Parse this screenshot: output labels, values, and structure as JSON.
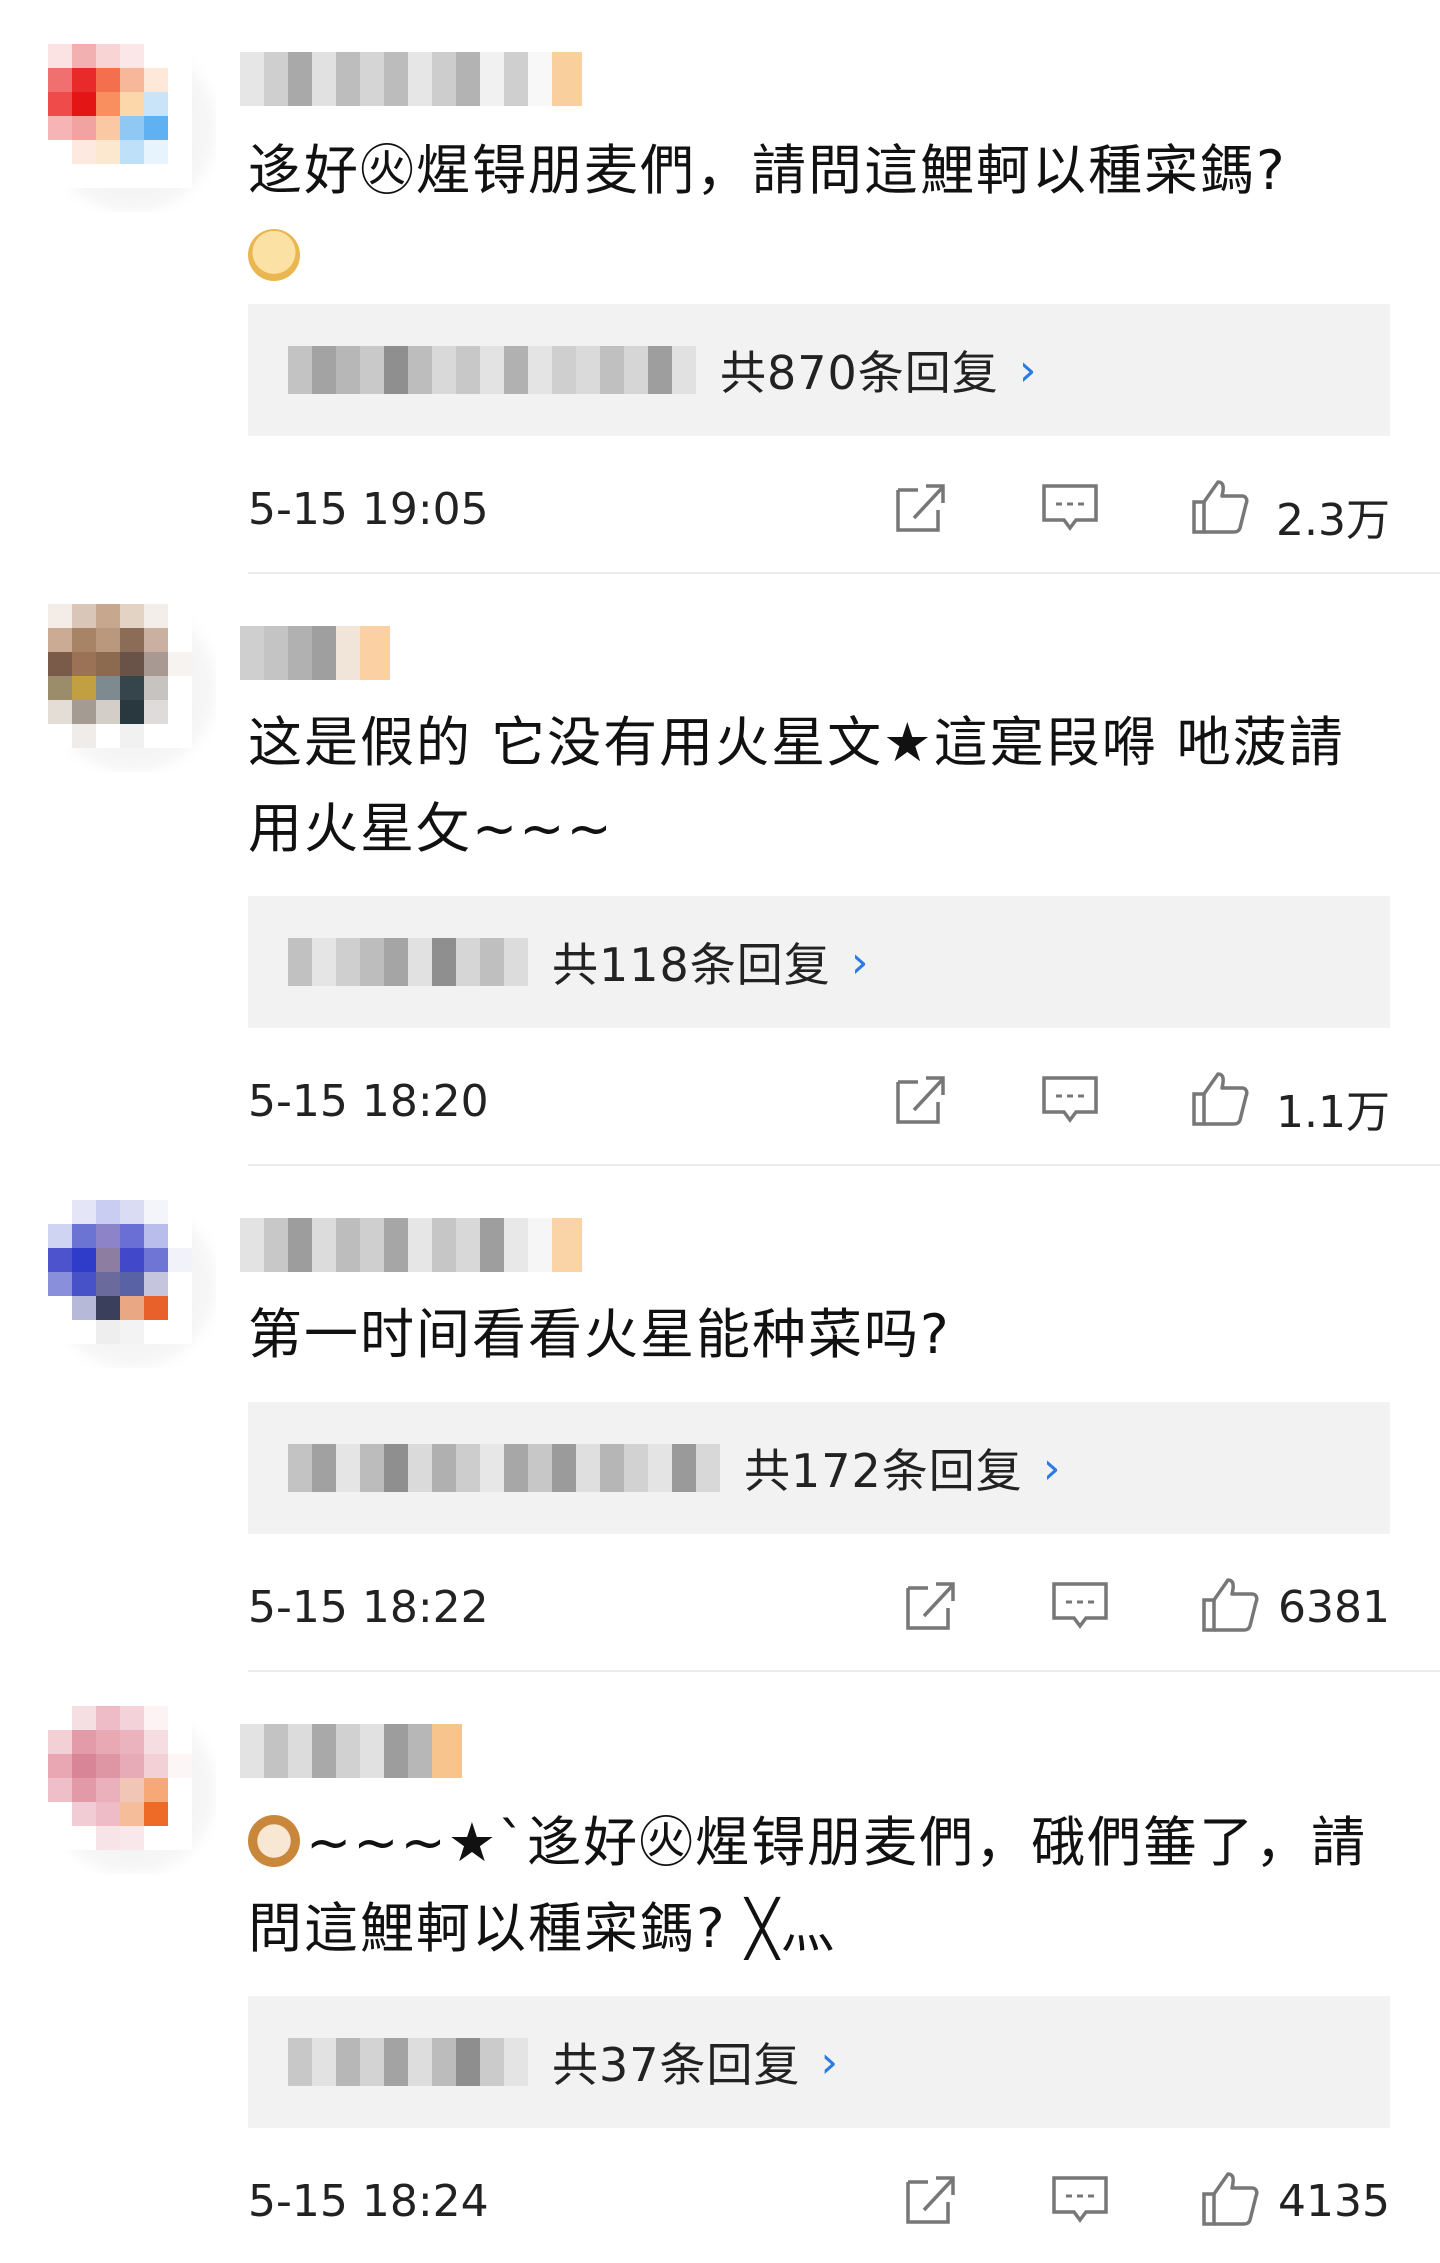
{
  "comments": [
    {
      "text": "迻好㊋煋锝朋麦們，請問這鯉軻以種寀鎷?",
      "emoji": "doge-emoji",
      "reply_count": "共870条回复",
      "time": "5-15 19:05",
      "likes": "2.3万"
    },
    {
      "text": "这是假的 它没有用火星文★這寔叚嘚 吔菠請用火星攵~~~",
      "emoji": "",
      "reply_count": "共118条回复",
      "time": "5-15 18:20",
      "likes": "1.1万"
    },
    {
      "text": "第一时间看看火星能种菜吗?",
      "emoji": "",
      "reply_count": "共172条回复",
      "time": "5-15 18:22",
      "likes": "6381"
    },
    {
      "text": "~~~★`迻好㊋煋锝朋麦們，硪們箠了，請問這鯉軻以種寀鎷? ╳灬",
      "emoji": "cat-emoji",
      "reply_count": "共37条回复",
      "time": "5-15 18:24",
      "likes": "4135"
    }
  ],
  "icons": {
    "share": "share-icon",
    "comment": "comment-icon",
    "like": "thumbs-up-icon",
    "chevron": "chevron-right-icon"
  },
  "colors": {
    "accent": "#2a7be4",
    "reply_bg": "#f2f2f2",
    "separator": "#ececec",
    "text": "#111111"
  }
}
